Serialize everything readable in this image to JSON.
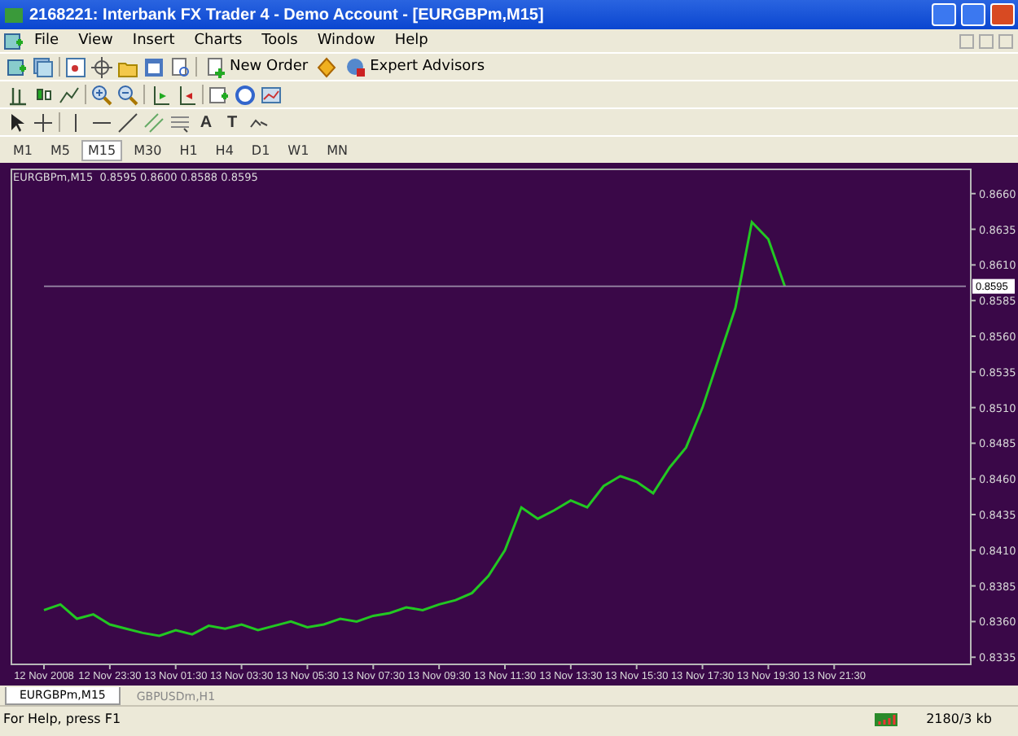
{
  "window": {
    "title": "2168221: Interbank FX Trader 4 - Demo Account - [EURGBPm,M15]"
  },
  "menu": [
    "File",
    "View",
    "Insert",
    "Charts",
    "Tools",
    "Window",
    "Help"
  ],
  "toolbar": {
    "buttons": [
      "New Order",
      "Expert Advisors"
    ],
    "text_tools": [
      "A",
      "T"
    ]
  },
  "timeframes": [
    {
      "label": "M1",
      "selected": false
    },
    {
      "label": "M5",
      "selected": false
    },
    {
      "label": "M15",
      "selected": true
    },
    {
      "label": "M30",
      "selected": false
    },
    {
      "label": "H1",
      "selected": false
    },
    {
      "label": "H4",
      "selected": false
    },
    {
      "label": "D1",
      "selected": false
    },
    {
      "label": "W1",
      "selected": false
    },
    {
      "label": "MN",
      "selected": false
    }
  ],
  "chart": {
    "info": "EURGBPm,M15  0.8595 0.8600 0.8588 0.8595",
    "price_label": "0.8595",
    "chart_data": {
      "type": "line",
      "ylim": [
        0.833,
        0.8677
      ],
      "series": [
        {
          "color": "#22c822",
          "values": [
            0.8368,
            0.8372,
            0.8362,
            0.8365,
            0.8358,
            0.8355,
            0.8352,
            0.835,
            0.8354,
            0.8351,
            0.8357,
            0.8355,
            0.8358,
            0.8354,
            0.8357,
            0.836,
            0.8356,
            0.8358,
            0.8362,
            0.836,
            0.8364,
            0.8366,
            0.837,
            0.8368,
            0.8372,
            0.8375,
            0.838,
            0.8392,
            0.841,
            0.844,
            0.8432,
            0.8438,
            0.8445,
            0.844,
            0.8455,
            0.8462,
            0.8458,
            0.845,
            0.8468,
            0.8482,
            0.851,
            0.8545,
            0.858,
            0.864,
            0.8628,
            0.8595,
            null,
            null,
            null,
            null,
            null,
            null,
            null,
            null,
            null,
            null,
            null
          ]
        },
        {
          "color": "#9a8aa8",
          "values": [
            0.8595,
            0.8595,
            0.8595,
            0.8595,
            0.8595,
            0.8595,
            0.8595,
            0.8595,
            0.8595,
            0.8595,
            0.8595,
            0.8595,
            0.8595,
            0.8595,
            0.8595,
            0.8595,
            0.8595,
            0.8595,
            0.8595,
            0.8595,
            0.8595,
            0.8595,
            0.8595,
            0.8595,
            0.8595,
            0.8595,
            0.8595,
            0.8595,
            0.8595,
            0.8595,
            0.8595,
            0.8595,
            0.8595,
            0.8595,
            0.8595,
            0.8595,
            0.8595,
            0.8595,
            0.8595,
            0.8595,
            0.8595,
            0.8595,
            0.8595,
            0.8595,
            0.8595,
            0.8595,
            0.8595,
            0.8595,
            0.8595,
            0.8595,
            0.8595,
            0.8595,
            0.8595,
            0.8595,
            0.8595,
            0.8595,
            0.8595
          ]
        }
      ],
      "categories": [
        "12 Nov 2008",
        null,
        null,
        null,
        "12 Nov 23:30",
        null,
        null,
        null,
        "13 Nov 01:30",
        null,
        null,
        null,
        "13 Nov 03:30",
        null,
        null,
        null,
        "13 Nov 05:30",
        null,
        null,
        null,
        "13 Nov 07:30",
        null,
        null,
        null,
        "13 Nov 09:30",
        null,
        null,
        null,
        "13 Nov 11:30",
        null,
        null,
        null,
        "13 Nov 13:30",
        null,
        null,
        null,
        "13 Nov 15:30",
        null,
        null,
        null,
        "13 Nov 17:30",
        null,
        null,
        null,
        "13 Nov 19:30",
        null,
        null,
        null,
        "13 Nov 21:30",
        null,
        null,
        null,
        null,
        null,
        null,
        null,
        null
      ],
      "yticks": [
        {
          "value": 0.866,
          "label": "0.8660"
        },
        {
          "value": 0.8635,
          "label": "0.8635"
        },
        {
          "value": 0.861,
          "label": "0.8610"
        },
        {
          "value": 0.8585,
          "label": "0.8585"
        },
        {
          "value": 0.856,
          "label": "0.8560"
        },
        {
          "value": 0.8535,
          "label": "0.8535"
        },
        {
          "value": 0.851,
          "label": "0.8510"
        },
        {
          "value": 0.8485,
          "label": "0.8485"
        },
        {
          "value": 0.846,
          "label": "0.8460"
        },
        {
          "value": 0.8435,
          "label": "0.8435"
        },
        {
          "value": 0.841,
          "label": "0.8410"
        },
        {
          "value": 0.8385,
          "label": "0.8385"
        },
        {
          "value": 0.836,
          "label": "0.8360"
        },
        {
          "value": 0.8335,
          "label": "0.8335"
        }
      ]
    }
  },
  "chart_tabs": [
    {
      "label": "EURGBPm,M15",
      "selected": true
    },
    {
      "label": "GBPUSDm,H1",
      "selected": false
    }
  ],
  "status_bar": {
    "help": "For Help, press F1",
    "traffic": "2180/3 kb"
  }
}
